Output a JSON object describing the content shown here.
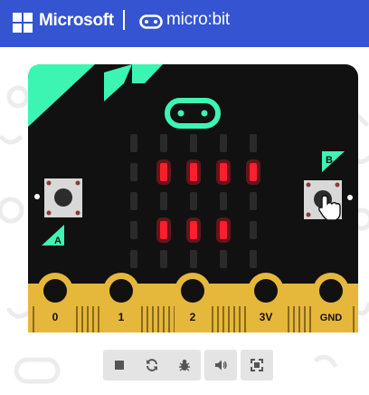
{
  "header": {
    "brand": "Microsoft",
    "product": "micro:bit",
    "background": "#3454d1"
  },
  "board": {
    "body_color": "#111111",
    "accent_color": "#3df5b2",
    "pad_color": "#e5b73b",
    "led_on_color": "#ff1e2c",
    "button_a_label": "A",
    "button_b_label": "B",
    "pins": [
      "0",
      "1",
      "2",
      "3V",
      "GND"
    ],
    "led_matrix": [
      [
        0,
        0,
        0,
        0,
        0
      ],
      [
        0,
        1,
        1,
        1,
        1
      ],
      [
        0,
        0,
        0,
        0,
        0
      ],
      [
        0,
        1,
        1,
        1,
        0
      ],
      [
        0,
        0,
        0,
        0,
        0
      ]
    ]
  },
  "toolbar": {
    "buttons": [
      {
        "name": "stop-button",
        "icon": "stop-icon"
      },
      {
        "name": "restart-button",
        "icon": "restart-icon"
      },
      {
        "name": "debug-button",
        "icon": "bug-icon"
      },
      {
        "name": "mute-button",
        "icon": "speaker-icon"
      },
      {
        "name": "fullscreen-button",
        "icon": "fullscreen-icon"
      }
    ]
  }
}
